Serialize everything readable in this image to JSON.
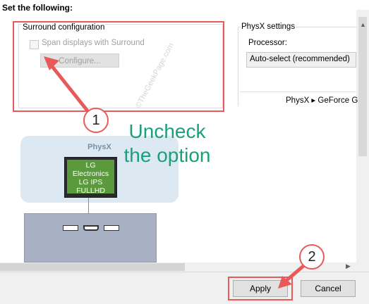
{
  "heading": "Set the following:",
  "surround": {
    "group_title": "Surround configuration",
    "checkbox_label": "Span displays with Surround",
    "checkbox_checked": false,
    "configure_label": "Configure..."
  },
  "physx": {
    "group_title": "PhysX settings",
    "processor_label": "Processor:",
    "processor_value": "Auto-select (recommended)",
    "footer_text": "PhysX ▸ GeForce G"
  },
  "diagram": {
    "title": "PhysX",
    "monitor_line1": "LG",
    "monitor_line2": "Electronics",
    "monitor_line3": "LG IPS",
    "monitor_line4": "FULLHD"
  },
  "buttons": {
    "apply_label": "Apply",
    "cancel_label": "Cancel"
  },
  "annotations": {
    "step1": "1",
    "step2": "2",
    "instruction": "Uncheck the option",
    "watermark": "©TheGeekPage.com",
    "highlight_color": "#e85a5a",
    "text_color": "#1aa07a"
  }
}
